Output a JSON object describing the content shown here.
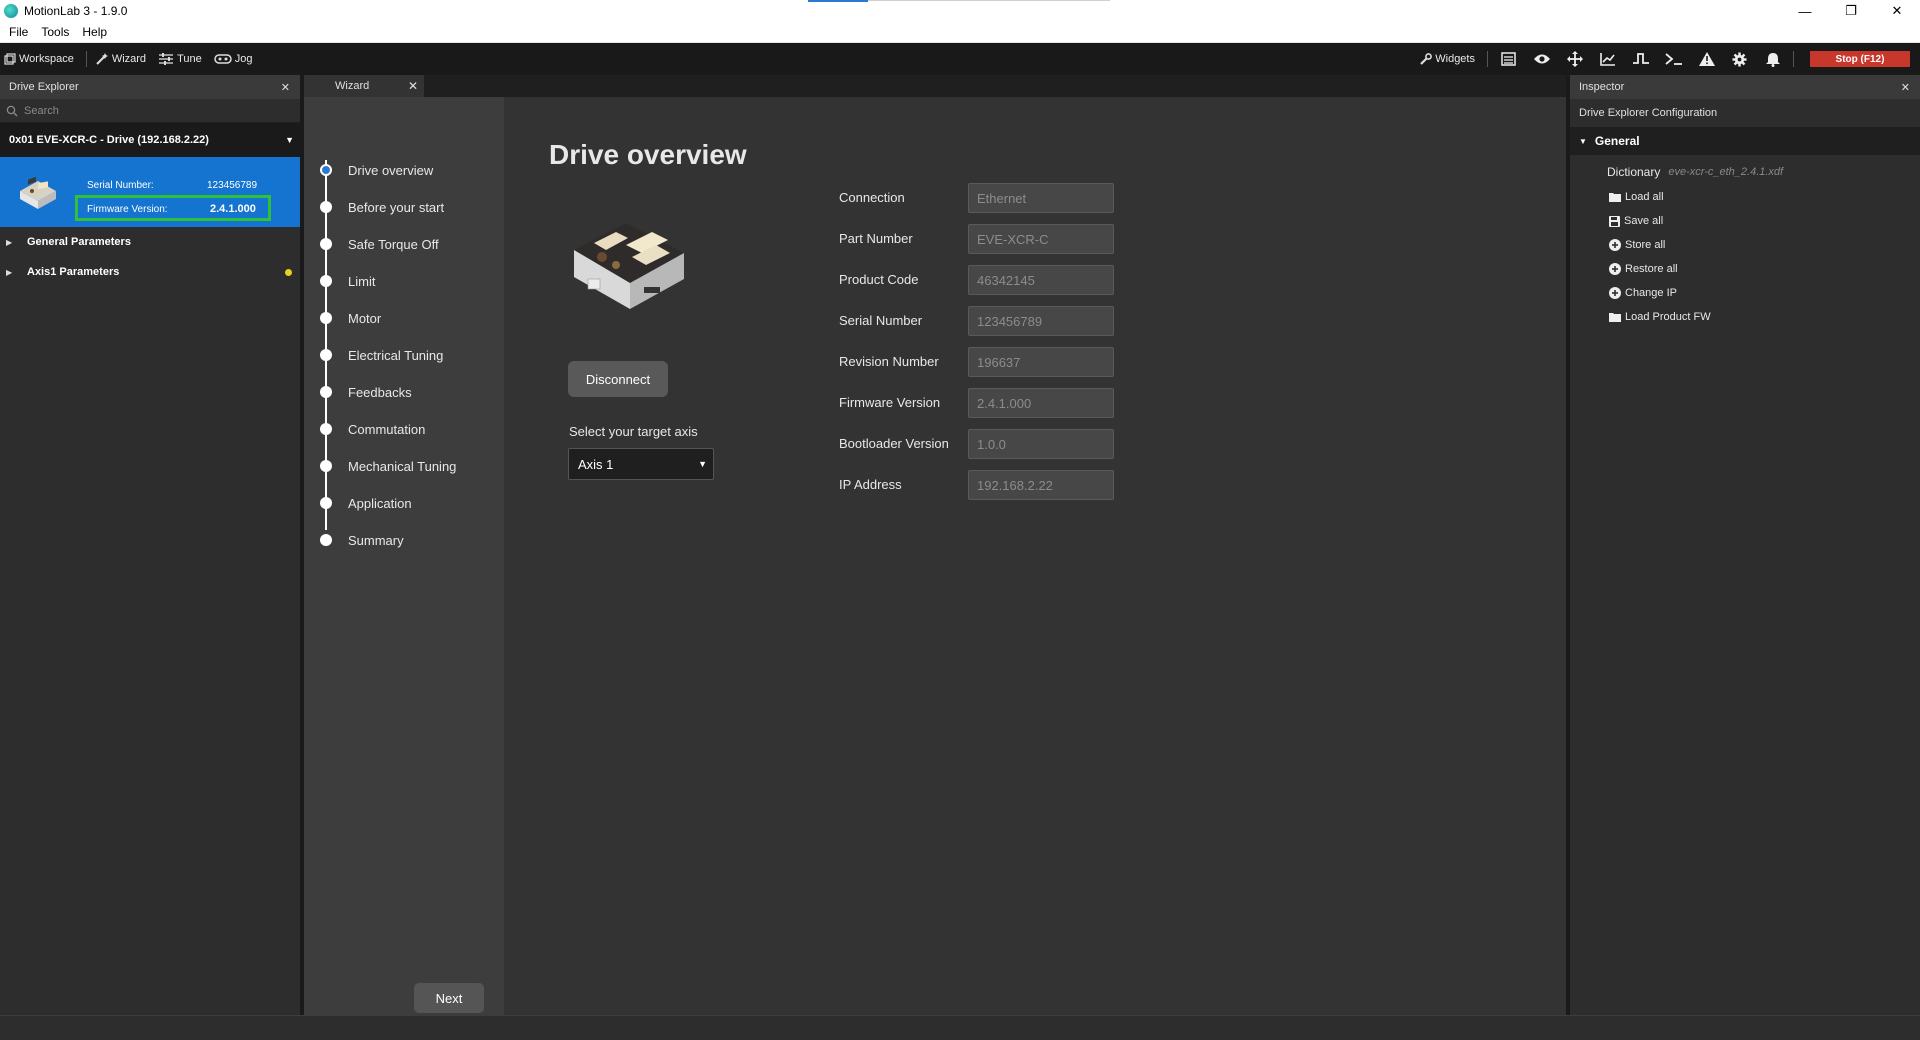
{
  "window": {
    "title": "MotionLab 3 - 1.9.0",
    "minimize": "—",
    "restore": "❐",
    "close": "✕"
  },
  "menu": [
    "File",
    "Tools",
    "Help"
  ],
  "toolbar": {
    "workspace": "Workspace",
    "wizard": "Wizard",
    "tune": "Tune",
    "jog": "Jog",
    "widgets": "Widgets",
    "stop": "Stop (F12)"
  },
  "drive_explorer": {
    "title": "Drive Explorer",
    "search_placeholder": "Search",
    "drive_label": "0x01  EVE-XCR-C - Drive (192.168.2.22)",
    "serial_label": "Serial Number:",
    "serial_value": "123456789",
    "firmware_label": "Firmware Version:",
    "firmware_value": "2.4.1.000",
    "tree": [
      "General Parameters",
      "Axis1 Parameters"
    ]
  },
  "wizard": {
    "tab": "Wizard",
    "steps": [
      "Drive overview",
      "Before your start",
      "Safe Torque Off",
      "Limit",
      "Motor",
      "Electrical Tuning",
      "Feedbacks",
      "Commutation",
      "Mechanical Tuning",
      "Application",
      "Summary"
    ],
    "next": "Next"
  },
  "overview": {
    "title": "Drive overview",
    "disconnect": "Disconnect",
    "axis_label": "Select your target axis",
    "axis_value": "Axis 1",
    "fields": [
      {
        "label": "Connection",
        "value": "Ethernet"
      },
      {
        "label": "Part Number",
        "value": "EVE-XCR-C"
      },
      {
        "label": "Product Code",
        "value": "46342145"
      },
      {
        "label": "Serial Number",
        "value": "123456789"
      },
      {
        "label": "Revision Number",
        "value": "196637"
      },
      {
        "label": "Firmware Version",
        "value": "2.4.1.000"
      },
      {
        "label": "Bootloader Version",
        "value": "1.0.0"
      },
      {
        "label": "IP Address",
        "value": "192.168.2.22"
      }
    ]
  },
  "inspector": {
    "title": "Inspector",
    "subtitle": "Drive Explorer Configuration",
    "section": "General",
    "dictionary_label": "Dictionary",
    "dictionary_file": "eve-xcr-c_eth_2.4.1.xdf",
    "actions": [
      "Load all",
      "Save all",
      "Store all",
      "Restore all",
      "Change IP",
      "Load Product FW"
    ]
  },
  "colors": {
    "accent": "#1474d0",
    "stop": "#c8372c",
    "highlight_box": "#2ec23a",
    "status_dot": "#e8d21a"
  }
}
